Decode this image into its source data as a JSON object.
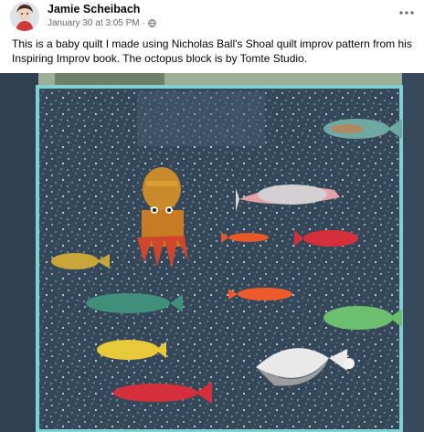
{
  "post": {
    "author": "Jamie Scheibach",
    "timestamp": "January 30 at 3:05 PM",
    "separator": "·",
    "audience_icon": "globe-icon",
    "more_icon": "more-options-icon",
    "text": "This is a baby quilt I made using Nicholas Ball's Shoal quilt improv pattern from his Inspiring Improv book. The octopus block is by Tomte Studio."
  },
  "photo": {
    "subject": "quilt-photo",
    "colors": {
      "quilt_background": "#34485a",
      "binding": "#7fd2d4",
      "octopus": "#c88a2a",
      "fish_red": "#d42f3a",
      "fish_orange": "#e8592a",
      "fish_green": "#63b56e",
      "fish_yellow": "#e7c93a",
      "fish_pink": "#e38e97",
      "fish_grey": "#d8d8d8"
    }
  }
}
